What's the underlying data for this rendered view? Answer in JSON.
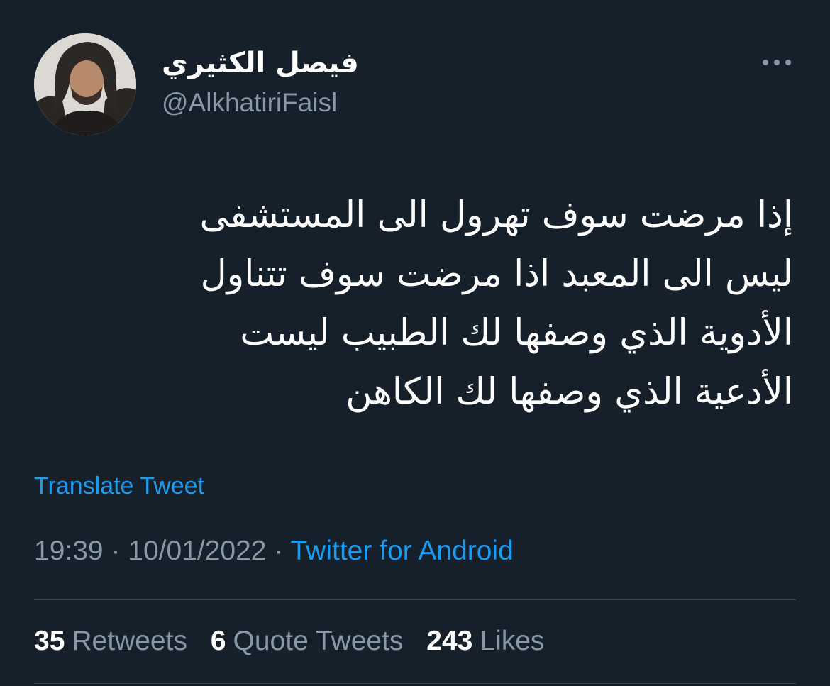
{
  "author": {
    "display_name": "فيصل الكثيري",
    "handle": "@AlkhatiriFaisl",
    "avatar_icon": "user-photo"
  },
  "menu": {
    "icon": "more-horizontal-icon",
    "label": "•••"
  },
  "tweet": {
    "lines": [
      "إذا مرضت سوف تهرول الى المستشفى",
      "ليس الى المعبد اذا مرضت سوف  تتناول",
      "الأدوية الذي وصفها لك الطبيب ليست",
      "الأدعية الذي وصفها لك الكاهن"
    ]
  },
  "translate_label": "Translate Tweet",
  "meta": {
    "time": "19:39",
    "separator": "·",
    "date": "10/01/2022",
    "source": "Twitter for Android"
  },
  "stats": {
    "retweets_count": "35",
    "retweets_label": "Retweets",
    "quotes_count": "6",
    "quotes_label": "Quote Tweets",
    "likes_count": "243",
    "likes_label": "Likes"
  },
  "colors": {
    "background": "#15202b",
    "link": "#1d9bf0",
    "secondary_text": "#8899a6",
    "divider": "#38444d"
  }
}
